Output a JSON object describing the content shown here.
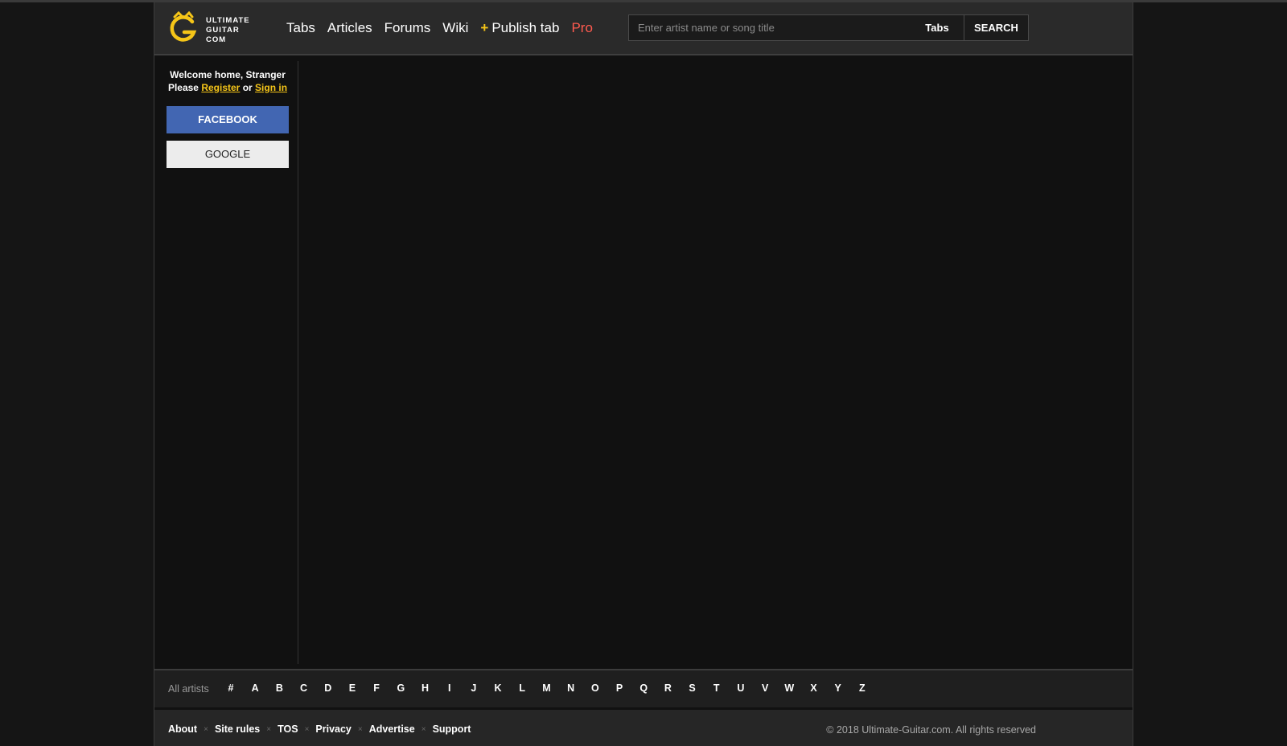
{
  "brand": {
    "logo_lines": [
      "ULTIMATE",
      "GUITAR",
      "COM"
    ],
    "accent_color": "#f5c518",
    "icon": "ug-logo-icon"
  },
  "nav": {
    "tabs": "Tabs",
    "articles": "Articles",
    "forums": "Forums",
    "wiki": "Wiki",
    "publish_plus": "+",
    "publish": "Publish tab",
    "pro": "Pro"
  },
  "search": {
    "placeholder": "Enter artist name or song title",
    "type": "Tabs",
    "button": "SEARCH"
  },
  "sidebar": {
    "welcome": "Welcome home, Stranger",
    "please": "Please",
    "register": "Register",
    "or": "or",
    "sign_in": "Sign in",
    "facebook": "FACEBOOK",
    "google": "GOOGLE",
    "facebook_color": "#4266b2"
  },
  "artists": {
    "label": "All artists",
    "letters": [
      "#",
      "A",
      "B",
      "C",
      "D",
      "E",
      "F",
      "G",
      "H",
      "I",
      "J",
      "K",
      "L",
      "M",
      "N",
      "O",
      "P",
      "Q",
      "R",
      "S",
      "T",
      "U",
      "V",
      "W",
      "X",
      "Y",
      "Z"
    ]
  },
  "footer": {
    "links": [
      "About",
      "Site rules",
      "TOS",
      "Privacy",
      "Advertise",
      "Support"
    ],
    "separator": "×",
    "copyright": "© 2018 Ultimate-Guitar.com. All rights reserved"
  }
}
